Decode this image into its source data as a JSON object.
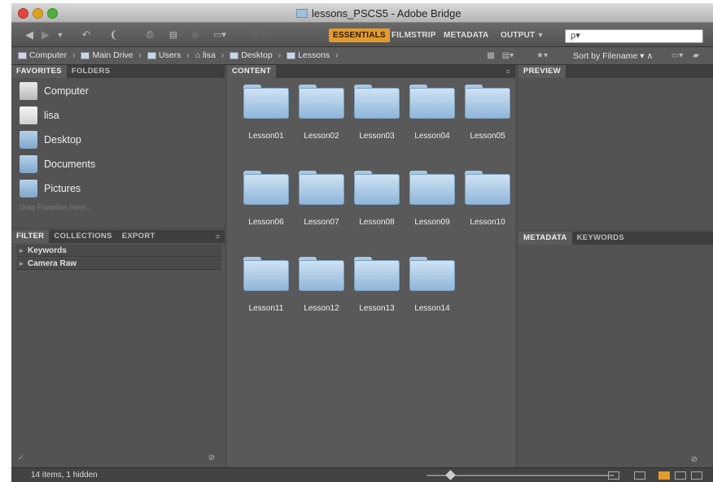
{
  "window": {
    "title": "lessons_PSCS5 - Adobe Bridge"
  },
  "toolbar": {
    "workspaces": [
      "ESSENTIALS",
      "FILMSTRIP",
      "METADATA",
      "OUTPUT"
    ],
    "active_workspace": "ESSENTIALS",
    "search_placeholder": "ρ▾"
  },
  "pathbar": {
    "crumbs": [
      "Computer",
      "Main Drive",
      "Users",
      "lisa",
      "Desktop",
      "Lessons"
    ],
    "sort_label": "Sort by Filename"
  },
  "favorites_panel": {
    "tabs": [
      "FAVORITES",
      "FOLDERS"
    ],
    "items": [
      "Computer",
      "lisa",
      "Desktop",
      "Documents",
      "Pictures"
    ],
    "drag_hint": "Drag Favorites Here..."
  },
  "filter_panel": {
    "tabs": [
      "FILTER",
      "COLLECTIONS",
      "EXPORT"
    ],
    "rows": [
      "Keywords",
      "Camera Raw"
    ]
  },
  "content_panel": {
    "tab": "CONTENT",
    "folders": [
      "Lesson01",
      "Lesson02",
      "Lesson03",
      "Lesson04",
      "Lesson05",
      "Lesson06",
      "Lesson07",
      "Lesson08",
      "Lesson09",
      "Lesson10",
      "Lesson11",
      "Lesson12",
      "Lesson13",
      "Lesson14"
    ]
  },
  "preview_panel": {
    "tab": "PREVIEW"
  },
  "metadata_panel": {
    "tabs": [
      "METADATA",
      "KEYWORDS"
    ]
  },
  "status": {
    "text": "14 items, 1 hidden"
  },
  "colors": {
    "accent": "#e49a2b",
    "panel_bg": "#535353",
    "folder": "#a8c8e6"
  }
}
